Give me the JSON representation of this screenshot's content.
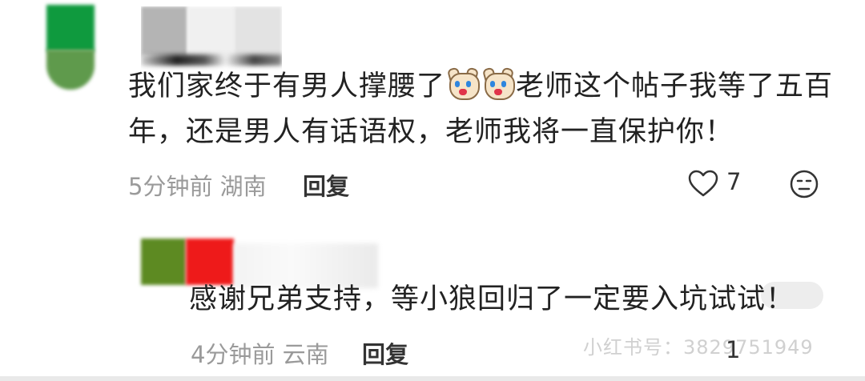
{
  "comment": {
    "text_part1": "我们家终于有男人撑腰了",
    "emoji_names": [
      "crying-dog-emoji",
      "crying-dog-emoji"
    ],
    "text_part2": "老师这个帖子我等了五百",
    "text_line2": "年，还是男人有话语权，老师我将一直保护你！",
    "time": "5分钟前",
    "location": "湖南",
    "reply_label": "回复",
    "like_count": "7"
  },
  "reply": {
    "text": "感谢兄弟支持，等小狼回归了一定要入坑试试！",
    "time": "4分钟前",
    "location": "云南",
    "reply_label": "回复",
    "like_count": "1"
  },
  "watermark": "小红书号：3829751949",
  "colors": {
    "avatar_green": "#0f9a3e",
    "avatar_red": "#ee1a1a",
    "meta_gray": "#9a9a9a"
  }
}
